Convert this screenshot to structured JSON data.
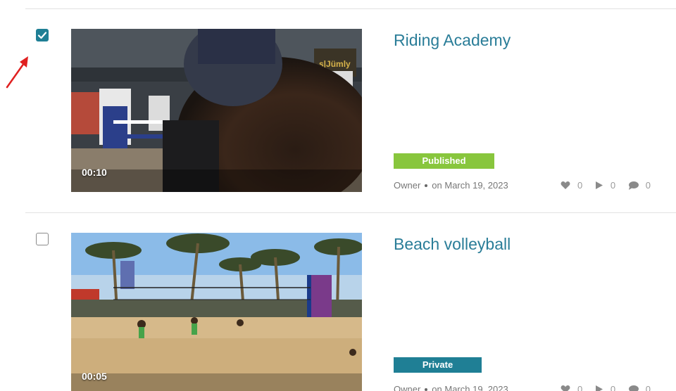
{
  "items": [
    {
      "title": "Riding Academy",
      "duration": "00:10",
      "status": "Published",
      "owner": "Owner",
      "date": "on March 19, 2023",
      "likes": "0",
      "plays": "0",
      "comments": "0",
      "selected": true
    },
    {
      "title": "Beach volleyball",
      "duration": "00:05",
      "status": "Private",
      "owner": "Owner",
      "date": "on March 19, 2023",
      "likes": "0",
      "plays": "0",
      "comments": "0",
      "selected": false
    }
  ],
  "colors": {
    "link": "#2a7d98",
    "published": "#88c63d",
    "private": "#1f7f95",
    "checkbox": "#1f7f95",
    "annotation_arrow": "#e02020"
  },
  "icons": {
    "likes": "heart-icon",
    "plays": "play-icon",
    "comments": "comment-icon",
    "annotation": "red-arrow-icon"
  }
}
